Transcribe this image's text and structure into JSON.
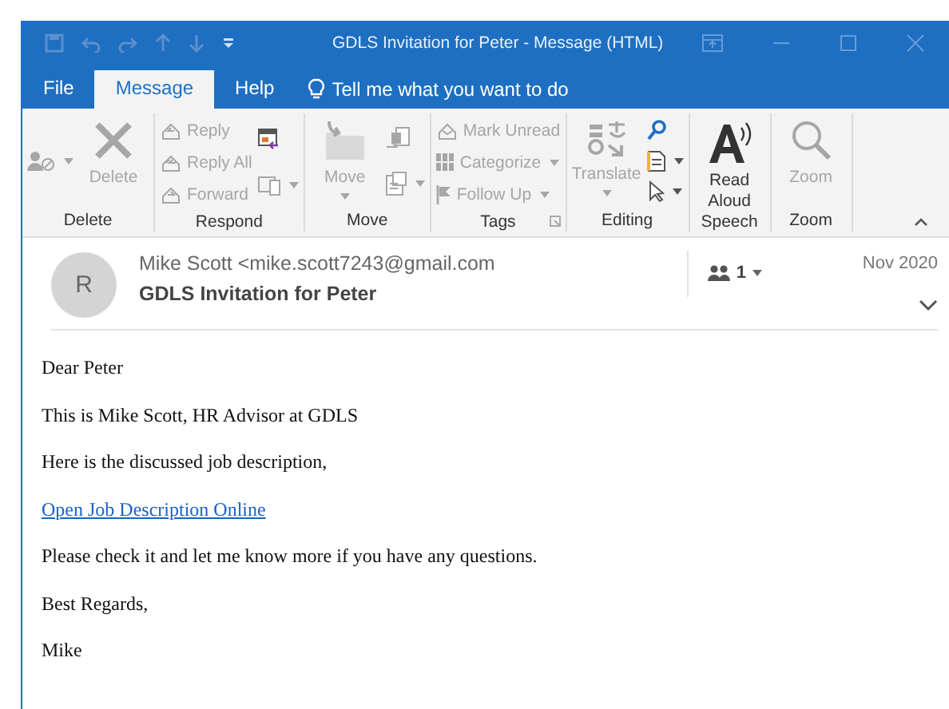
{
  "title_bar": {
    "title": "GDLS Invitation for Peter  -  Message (HTML)"
  },
  "tabs": [
    {
      "label": "File",
      "selected": false
    },
    {
      "label": "Message",
      "selected": true
    },
    {
      "label": "Help",
      "selected": false
    }
  ],
  "tell_me": "Tell me what you want to do",
  "ribbon": [
    {
      "label": "Delete",
      "items": [
        {
          "kind": "icon",
          "disabled": true,
          "dropdown": true
        },
        {
          "kind": "large",
          "label": "Delete",
          "disabled": true,
          "dropdown": false
        }
      ]
    },
    {
      "label": "Respond",
      "items": [
        {
          "kind": "small",
          "label": "Reply",
          "disabled": true,
          "dropdown": false
        },
        {
          "kind": "small",
          "label": "Reply All",
          "disabled": true,
          "dropdown": false
        },
        {
          "kind": "small",
          "label": "Forward",
          "disabled": true,
          "dropdown": false
        },
        {
          "kind": "icon",
          "disabled": false,
          "dropdown": false
        },
        {
          "kind": "icon",
          "disabled": true,
          "dropdown": true
        }
      ]
    },
    {
      "label": "Move",
      "items": [
        {
          "kind": "large",
          "label": "Move",
          "disabled": true,
          "dropdown": true
        },
        {
          "kind": "icon",
          "disabled": true,
          "dropdown": false
        },
        {
          "kind": "icon",
          "disabled": true,
          "dropdown": true
        }
      ]
    },
    {
      "label": "Tags",
      "launcher": true,
      "items": [
        {
          "kind": "small",
          "label": "Mark Unread",
          "disabled": true,
          "dropdown": false
        },
        {
          "kind": "small",
          "label": "Categorize",
          "disabled": true,
          "dropdown": true
        },
        {
          "kind": "small",
          "label": "Follow Up",
          "disabled": true,
          "dropdown": true
        }
      ]
    },
    {
      "label": "Editing",
      "items": [
        {
          "kind": "large",
          "label": "Translate",
          "disabled": true,
          "dropdown": true
        },
        {
          "kind": "icon",
          "disabled": false,
          "dropdown": false
        },
        {
          "kind": "icon",
          "disabled": false,
          "dropdown": true
        },
        {
          "kind": "icon",
          "disabled": false,
          "dropdown": true
        }
      ]
    },
    {
      "label": "Speech",
      "items": [
        {
          "kind": "large",
          "label": "Read Aloud",
          "disabled": false,
          "dropdown": false
        }
      ]
    },
    {
      "label": "Zoom",
      "items": [
        {
          "kind": "large",
          "label": "Zoom",
          "disabled": true,
          "dropdown": false
        }
      ]
    }
  ],
  "header": {
    "avatar": "R",
    "from": "Mike Scott <mike.scott7243@gmail.com",
    "subject": "GDLS Invitation for Peter",
    "people_count": "1",
    "date": "Nov 2020"
  },
  "body": [
    {
      "kind": "text",
      "text": "Dear Peter"
    },
    {
      "kind": "text",
      "text": "This is Mike Scott, HR Advisor at GDLS"
    },
    {
      "kind": "text",
      "text": "Here is the discussed job description,"
    },
    {
      "kind": "link",
      "text": "Open Job Description Online"
    },
    {
      "kind": "text",
      "text": "Please check it and let me know more if you have any questions."
    },
    {
      "kind": "text",
      "text": "Best Regards,"
    },
    {
      "kind": "text",
      "text": "Mike"
    }
  ]
}
